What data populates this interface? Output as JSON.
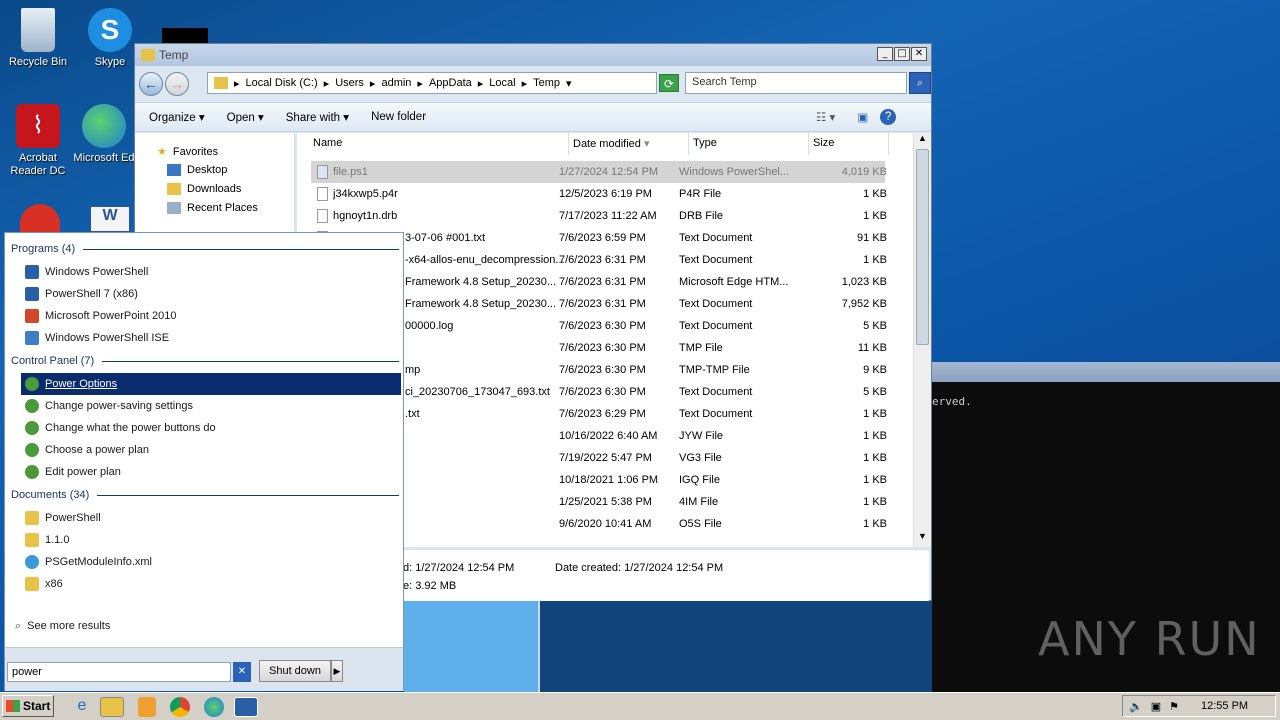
{
  "desktop": {
    "icons": [
      {
        "label": "Recycle Bin"
      },
      {
        "label": "Skype"
      },
      {
        "label": "Acrobat Reader DC"
      },
      {
        "label": "Microsoft Ed"
      }
    ]
  },
  "explorer": {
    "title": "Temp",
    "breadcrumb": [
      "Local Disk (C:)",
      "Users",
      "admin",
      "AppData",
      "Local",
      "Temp"
    ],
    "search_placeholder": "Search Temp",
    "toolbar": {
      "organize": "Organize",
      "open": "Open",
      "share_with": "Share with",
      "new_folder": "New folder"
    },
    "nav": {
      "favorites": "Favorites",
      "desktop": "Desktop",
      "downloads": "Downloads",
      "recent": "Recent Places"
    },
    "columns": {
      "name": "Name",
      "date": "Date modified",
      "type": "Type",
      "size": "Size"
    },
    "files": [
      {
        "name": "file.ps1",
        "date": "1/27/2024 12:54 PM",
        "type": "Windows PowerShel...",
        "size": "4,019 KB"
      },
      {
        "name": "j34kxwp5.p4r",
        "date": "12/5/2023 6:19 PM",
        "type": "P4R File",
        "size": "1 KB"
      },
      {
        "name": "hgnoyt1n.drb",
        "date": "7/17/2023 11:22 AM",
        "type": "DRB File",
        "size": "1 KB"
      },
      {
        "name": "3-07-06 #001.txt",
        "date": "7/6/2023 6:59 PM",
        "type": "Text Document",
        "size": "91 KB"
      },
      {
        "name": "-x64-allos-enu_decompression...",
        "date": "7/6/2023 6:31 PM",
        "type": "Text Document",
        "size": "1 KB"
      },
      {
        "name": "Framework 4.8 Setup_20230...",
        "date": "7/6/2023 6:31 PM",
        "type": "Microsoft Edge HTM...",
        "size": "1,023 KB"
      },
      {
        "name": "Framework 4.8 Setup_20230...",
        "date": "7/6/2023 6:31 PM",
        "type": "Text Document",
        "size": "7,952 KB"
      },
      {
        "name": "00000.log",
        "date": "7/6/2023 6:30 PM",
        "type": "Text Document",
        "size": "5 KB"
      },
      {
        "name": "",
        "date": "7/6/2023 6:30 PM",
        "type": "TMP File",
        "size": "11 KB"
      },
      {
        "name": "mp",
        "date": "7/6/2023 6:30 PM",
        "type": "TMP-TMP File",
        "size": "9 KB"
      },
      {
        "name": "ci_20230706_173047_693.txt",
        "date": "7/6/2023 6:30 PM",
        "type": "Text Document",
        "size": "5 KB"
      },
      {
        "name": ".txt",
        "date": "7/6/2023 6:29 PM",
        "type": "Text Document",
        "size": "1 KB"
      },
      {
        "name": "",
        "date": "10/16/2022 6:40 AM",
        "type": "JYW File",
        "size": "1 KB"
      },
      {
        "name": "",
        "date": "7/19/2022 5:47 PM",
        "type": "VG3 File",
        "size": "1 KB"
      },
      {
        "name": "",
        "date": "10/18/2021 1:06 PM",
        "type": "IGQ File",
        "size": "1 KB"
      },
      {
        "name": "",
        "date": "1/25/2021 5:38 PM",
        "type": "4IM File",
        "size": "1 KB"
      },
      {
        "name": "",
        "date": "9/6/2020 10:41 AM",
        "type": "O5S File",
        "size": "1 KB"
      }
    ],
    "details": {
      "modified": "d: 1/27/2024 12:54 PM",
      "created": "Date created: 1/27/2024 12:54 PM",
      "size": "e: 3.92 MB"
    }
  },
  "cmd": {
    "text": "erved."
  },
  "start_menu": {
    "programs_header": "Programs (4)",
    "programs": [
      "Windows PowerShell",
      "PowerShell 7 (x86)",
      "Microsoft PowerPoint 2010",
      "Windows PowerShell ISE"
    ],
    "control_header": "Control Panel (7)",
    "control": [
      "Power Options",
      "Change power-saving settings",
      "Change what the power buttons do",
      "Choose a power plan",
      "Edit power plan"
    ],
    "documents_header": "Documents (34)",
    "documents": [
      "PowerShell",
      "1.1.0",
      "PSGetModuleInfo.xml",
      "x86"
    ],
    "see_more": "See more results",
    "search_value": "power",
    "shutdown": "Shut down"
  },
  "taskbar": {
    "start": "Start",
    "clock": "12:55 PM"
  },
  "watermark": "ANY RUN"
}
